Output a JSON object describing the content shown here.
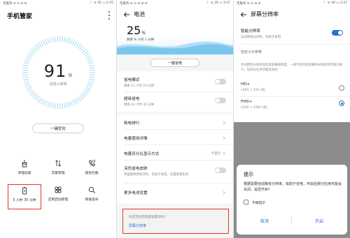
{
  "status": {
    "p1_left": "无服务 ✉ ⊙ ⊡ ⊡",
    "p1_right": "☾ ⊘ 35 ▭ 2:55",
    "p2_left": "无服务 ✉ ⊙ ⊡ ⊡ ⊡",
    "p2_right": "☾ ⊘ 39 ▭ 3:47",
    "p3_left": "无服务 ✉ ⊙ ⊡ ⊡",
    "p3_right": "☾ ⊘ 38 ▭ 3:47"
  },
  "manager": {
    "title": "手机管家",
    "score": "91",
    "score_unit": "分",
    "hint": "请放心使用",
    "optimize": "一键优化",
    "tiles": [
      {
        "label": "清理加速"
      },
      {
        "label": "流量管理"
      },
      {
        "label": "骚扰拦截"
      },
      {
        "label": "5 小时 35 分钟"
      },
      {
        "label": "应用启动管理"
      },
      {
        "label": "病毒查杀"
      }
    ]
  },
  "battery": {
    "title": "电池",
    "percent": "25",
    "percent_unit": "%",
    "remain": "剩余 9 小时 3 分钟",
    "saver_btn": "一键省电",
    "save_mode_title": "省电模式",
    "save_mode_sub": "剩余 11 小时 19 分钟",
    "ultra_title": "超级省电",
    "ultra_sub": "剩余 43 小时 46 分钟",
    "ranking": "耗电排行",
    "usage": "电量使用详情",
    "pct_display": "电量百分比显示方式",
    "pct_display_value": "不显示",
    "dark_title": "深色省电皮肤",
    "dark_sub": "界面颜色更加深色，有助于省电，设置后将生效",
    "more": "更多电池设置",
    "suggest_q": "你是否找到电量设置项吗？",
    "suggest_link": "屏幕分辨率"
  },
  "resolution": {
    "title": "屏幕分辨率",
    "smart_title": "智能分辨率",
    "smart_sub": "自动降低分辨率，有助于省电",
    "custom_label": "自定义分辨率",
    "custom_desc": "手动更改分辨率会改变屏幕观感度，一般不会改变屏幕布局和程序的放大缩小，但部分应用可能会关闭",
    "hd_title": "HD+",
    "hd_sub": "1493 × 720 (低)",
    "fhd_title": "FHD+",
    "fhd_sub": "2240 × 1080 (高)"
  },
  "dialog": {
    "title": "提示",
    "message": "根据需要自动降低分辨率，有助于省电，开启后部分应用可能会关闭。是否开启？",
    "no_remind": "不再提示",
    "cancel": "取消",
    "ok": "开启"
  },
  "colors": {
    "accent": "#2a6fd6",
    "highlight": "#e2372b"
  }
}
